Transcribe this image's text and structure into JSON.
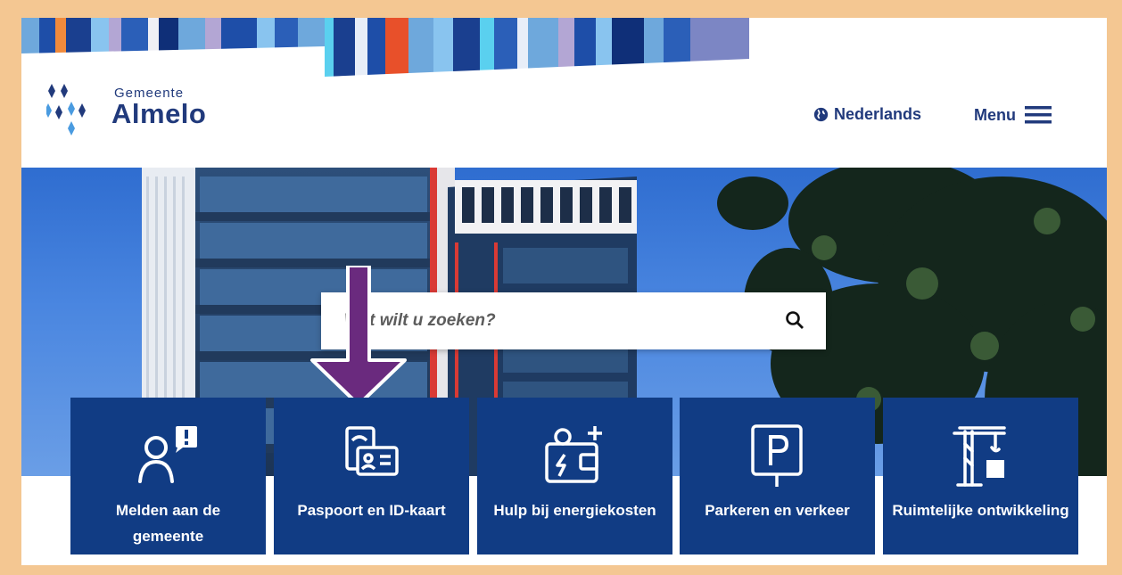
{
  "header": {
    "logo_small": "Gemeente",
    "logo_big": "Almelo",
    "language": "Nederlands",
    "menu": "Menu"
  },
  "search": {
    "placeholder": "Wat wilt u zoeken?"
  },
  "tiles": [
    {
      "label": "Melden aan de gemeente",
      "icon": "report-person-icon"
    },
    {
      "label": "Paspoort en ID-kaart",
      "icon": "passport-id-icon"
    },
    {
      "label": "Hulp bij energiekosten",
      "icon": "energy-wallet-icon"
    },
    {
      "label": "Parkeren en verkeer",
      "icon": "parking-icon"
    },
    {
      "label": "Ruimtelijke ontwikkeling",
      "icon": "crane-icon"
    }
  ],
  "colors": {
    "brand_blue": "#113c84",
    "text_blue": "#213a7c",
    "frame": "#f4c792",
    "annotation_arrow": "#6a2a7e"
  }
}
